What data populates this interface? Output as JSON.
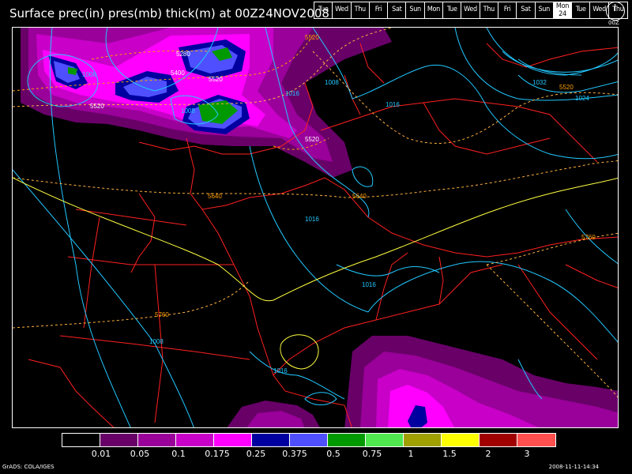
{
  "title": "Surface prec(in) pres(mb) thick(m) at 00Z24NOV2008",
  "days": [
    {
      "label": "Tue",
      "active": false
    },
    {
      "label": "Wed",
      "active": false
    },
    {
      "label": "Thu",
      "active": false
    },
    {
      "label": "Fri",
      "active": false
    },
    {
      "label": "Sat",
      "active": false
    },
    {
      "label": "Sun",
      "active": false
    },
    {
      "label": "Mon",
      "active": false
    },
    {
      "label": "Tue",
      "active": false
    },
    {
      "label": "Wed",
      "active": false
    },
    {
      "label": "Thu",
      "active": false
    },
    {
      "label": "Fri",
      "active": false
    },
    {
      "label": "Sat",
      "active": false
    },
    {
      "label": "Sun",
      "active": false
    },
    {
      "label": "Mon",
      "num": "24",
      "active": true
    },
    {
      "label": "Tue",
      "active": false
    },
    {
      "label": "Wed",
      "active": false
    },
    {
      "label": "Thu",
      "active": false
    }
  ],
  "clock_label": "00Z",
  "colorbar": {
    "colors": [
      "#000000",
      "#680068",
      "#9a009a",
      "#c800c8",
      "#ff00ff",
      "#0000a0",
      "#4f4fff",
      "#009a00",
      "#4fe84f",
      "#a0a000",
      "#ffff00",
      "#a00000",
      "#ff4f4f"
    ],
    "labels": [
      "0.01",
      "0.05",
      "0.1",
      "0.175",
      "0.25",
      "0.375",
      "0.5",
      "0.75",
      "1",
      "1.5",
      "2",
      "3"
    ]
  },
  "contour_labels": {
    "pressure": [
      "1008",
      "1008",
      "1016",
      "1008",
      "1016",
      "1032",
      "1024",
      "1016",
      "1016",
      "1008",
      "1016"
    ],
    "thickness": [
      "5520",
      "5280",
      "5400",
      "5520",
      "5520",
      "5520",
      "5520",
      "5640",
      "5640",
      "5760",
      "5760"
    ]
  },
  "footer_left": "GrADS: COLA/IGES",
  "footer_right": "2008-11-11-14:34"
}
